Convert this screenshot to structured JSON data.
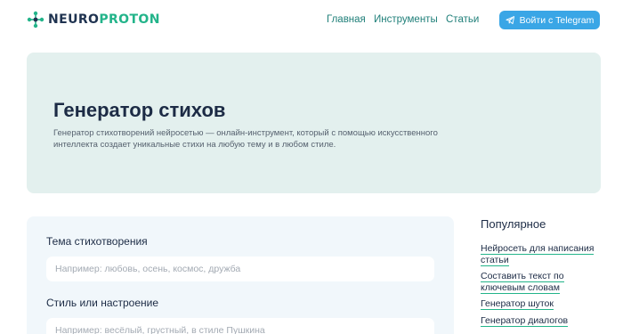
{
  "header": {
    "logo": {
      "part1": "NEURO",
      "part2": "PROTON"
    },
    "nav": [
      {
        "label": "Главная"
      },
      {
        "label": "Инструменты"
      },
      {
        "label": "Статьи"
      }
    ],
    "login_button": "Войти с Telegram"
  },
  "hero": {
    "title": "Генератор стихов",
    "description": "Генератор стихотворений нейросетью — онлайн-инструмент, который с помощью искусственного интеллекта создает уникальные стихи на любую тему и в любом стиле."
  },
  "form": {
    "topic": {
      "label": "Тема стихотворения",
      "placeholder": "Например: любовь, осень, космос, дружба",
      "value": ""
    },
    "style": {
      "label": "Стиль или настроение",
      "placeholder": "Например: весёлый, грустный, в стиле Пушкина",
      "value": ""
    }
  },
  "sidebar": {
    "title": "Популярное",
    "links": [
      {
        "line1": "Нейросеть для написания",
        "line2": "статьи"
      },
      {
        "line1": "Составить текст по",
        "line2": "ключевым словам"
      },
      {
        "line1": "Генератор шуток",
        "line2": ""
      },
      {
        "line1": "Генератор диалогов",
        "line2": ""
      }
    ]
  },
  "colors": {
    "brand_dark": "#1f3350",
    "brand_green": "#23b48a",
    "telegram": "#3aa6e6",
    "hero_bg": "#e3f0ee"
  },
  "icons": {
    "logo": "neuron-logo-icon",
    "telegram": "telegram-plane-icon"
  }
}
